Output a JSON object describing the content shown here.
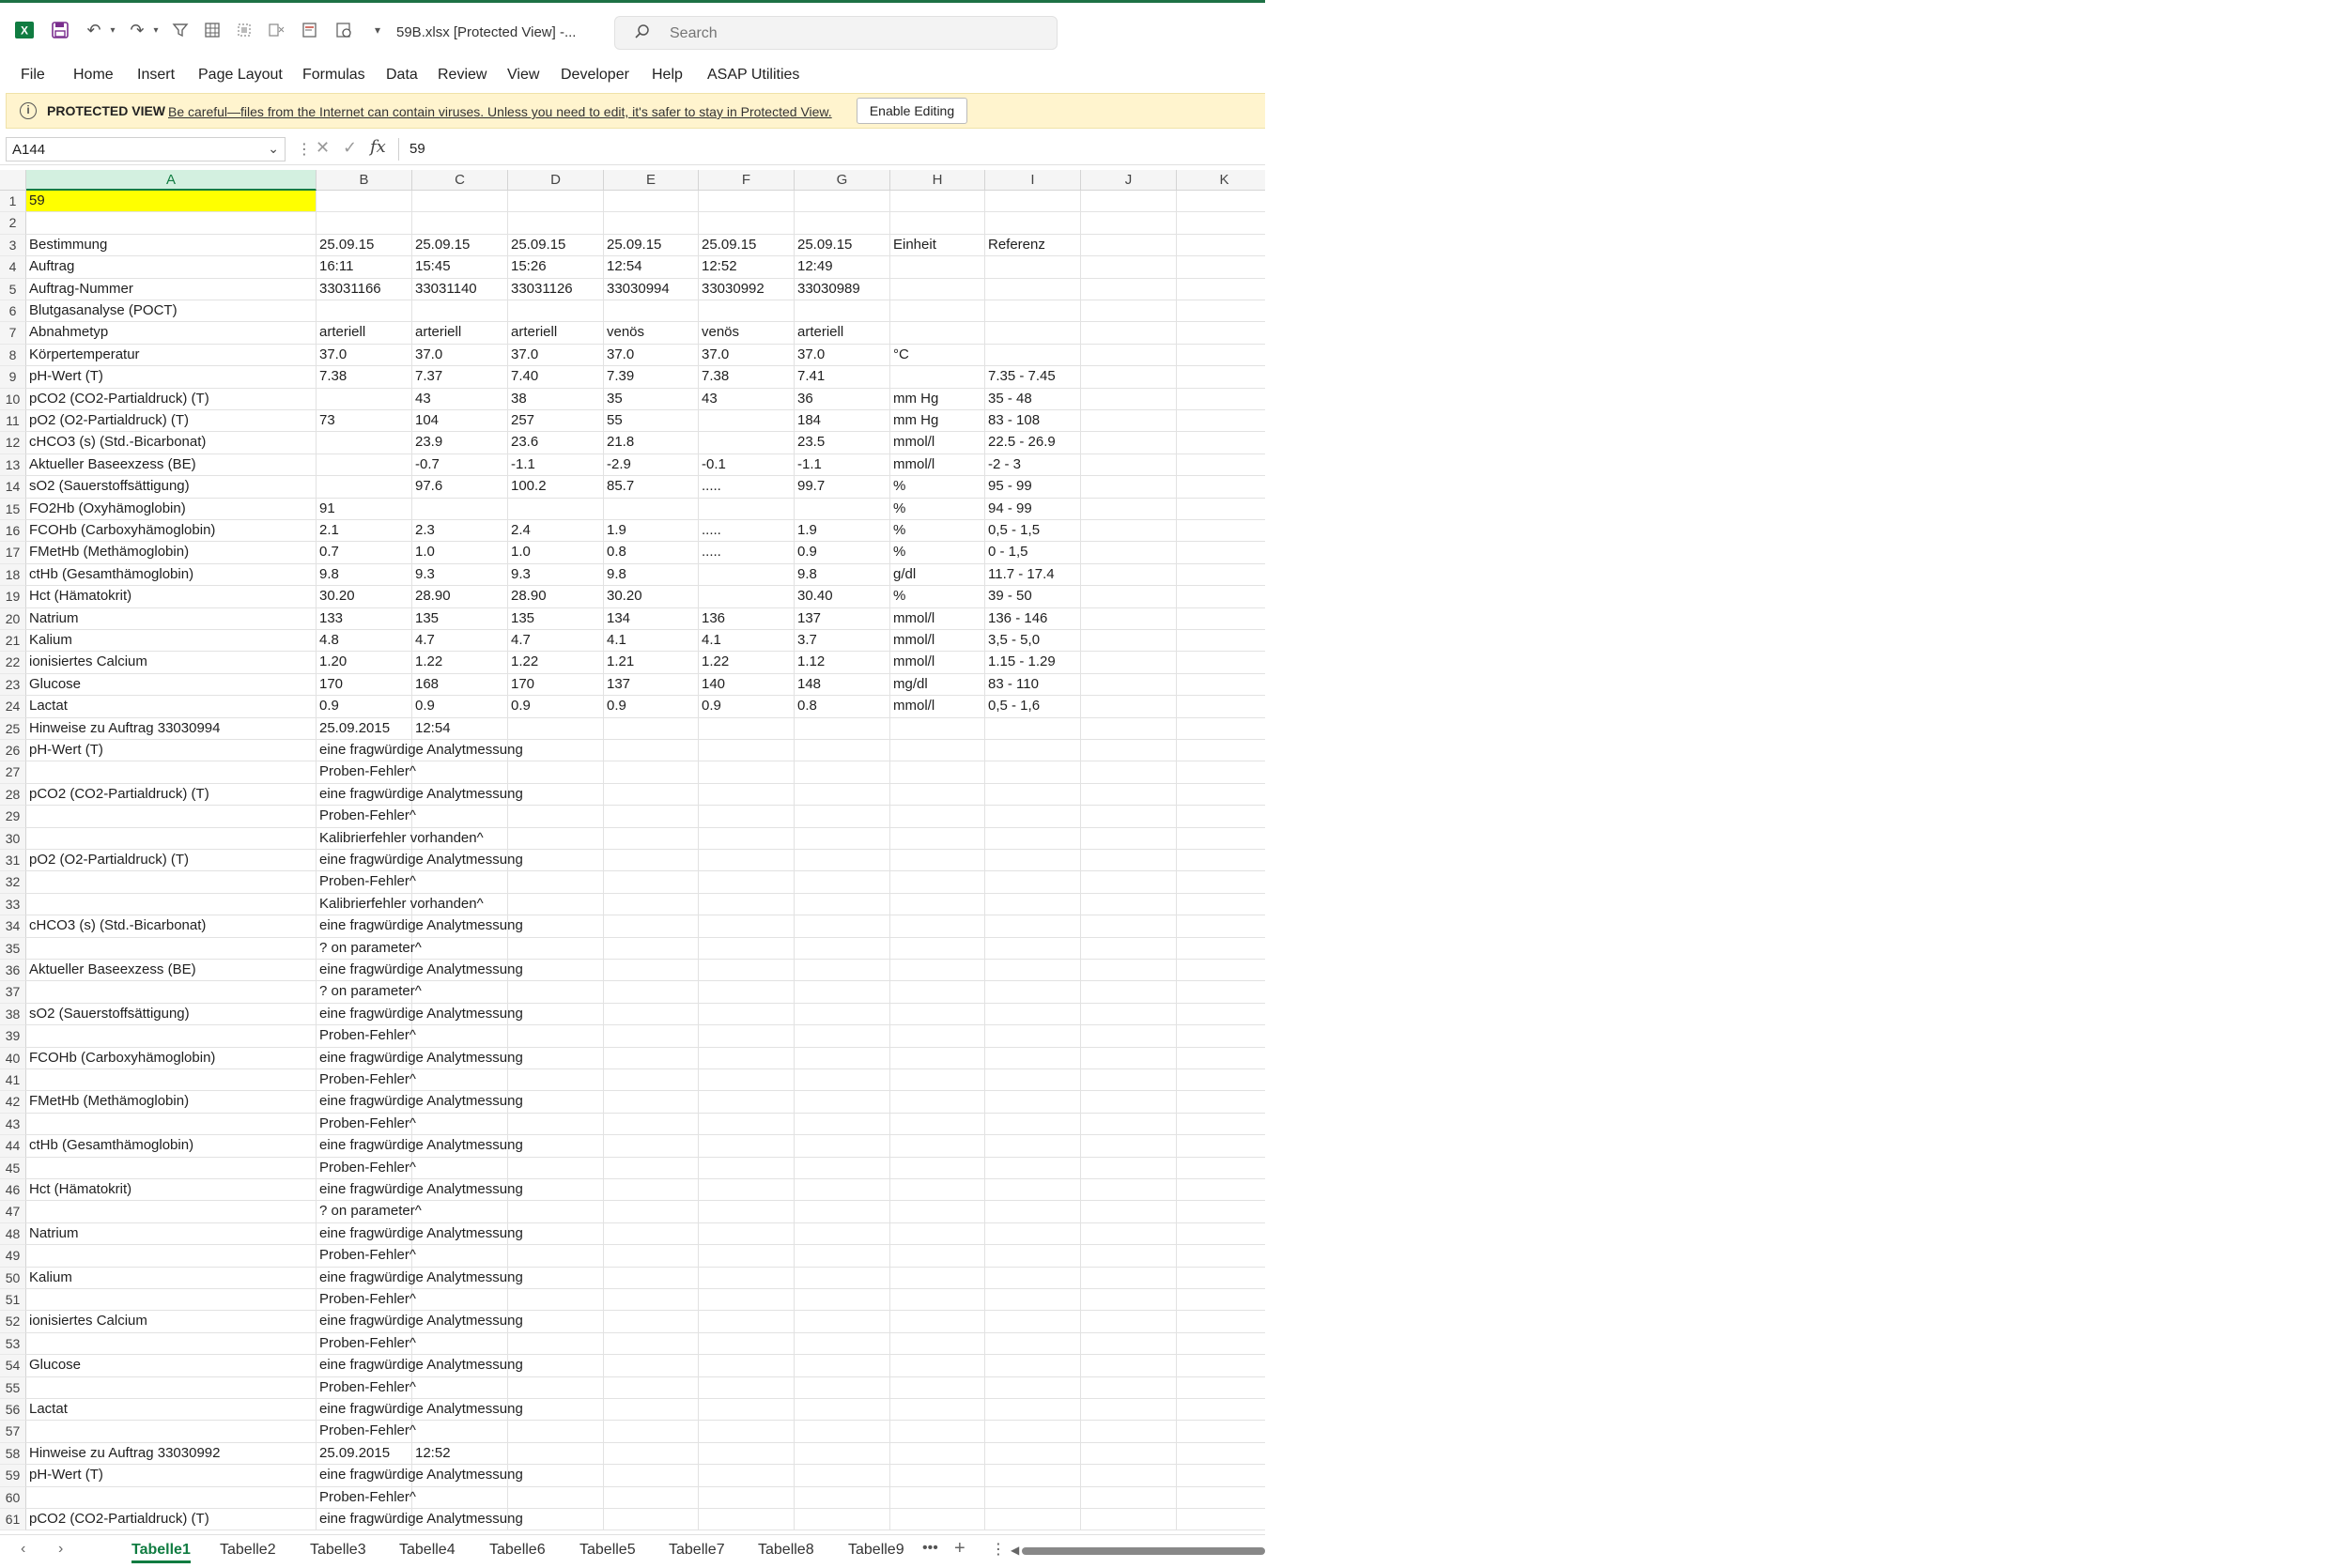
{
  "window": {
    "title": "59B.xlsx  [Protected View]  -..."
  },
  "search": {
    "placeholder": "Search"
  },
  "menu": [
    "File",
    "Home",
    "Insert",
    "Page Layout",
    "Formulas",
    "Data",
    "Review",
    "View",
    "Developer",
    "Help",
    "ASAP Utilities"
  ],
  "protected_view": {
    "label": "PROTECTED VIEW",
    "message": "Be careful—files from the Internet can contain viruses. Unless you need to edit, it's safer to stay in Protected View.",
    "button": "Enable Editing"
  },
  "formula_bar": {
    "name_box": "A144",
    "value": "59"
  },
  "columns": [
    "A",
    "B",
    "C",
    "D",
    "E",
    "F",
    "G",
    "H",
    "I",
    "J",
    "K"
  ],
  "selected_column": "A",
  "rows": [
    [
      "59",
      "",
      "",
      "",
      "",
      "",
      "",
      "",
      ""
    ],
    [
      "",
      "",
      "",
      "",
      "",
      "",
      "",
      "",
      ""
    ],
    [
      "Bestimmung",
      "25.09.15",
      "25.09.15",
      "25.09.15",
      "25.09.15",
      "25.09.15",
      "25.09.15",
      "Einheit",
      "Referenz"
    ],
    [
      "Auftrag",
      "16:11",
      "15:45",
      "15:26",
      "12:54",
      "12:52",
      "12:49",
      "",
      ""
    ],
    [
      "Auftrag-Nummer",
      "33031166",
      "33031140",
      "33031126",
      "33030994",
      "33030992",
      "33030989",
      "",
      ""
    ],
    [
      "Blutgasanalyse (POCT)",
      "",
      "",
      "",
      "",
      "",
      "",
      "",
      ""
    ],
    [
      "Abnahmetyp",
      "arteriell",
      "arteriell",
      "arteriell",
      "venös",
      "venös",
      "arteriell",
      "",
      ""
    ],
    [
      "Körpertemperatur",
      "37.0",
      "37.0",
      "37.0",
      "37.0",
      "37.0",
      "37.0",
      "°C",
      ""
    ],
    [
      "pH-Wert (T)",
      "7.38",
      "7.37",
      "7.40",
      "7.39",
      "7.38",
      "7.41",
      "",
      "7.35 - 7.45"
    ],
    [
      "pCO2 (CO2-Partialdruck) (T)",
      "",
      "43",
      "38",
      "35",
      "43",
      "36",
      "mm Hg",
      "35 - 48"
    ],
    [
      "pO2 (O2-Partialdruck) (T)",
      "73",
      "104",
      "257",
      "55",
      "",
      "184",
      "mm Hg",
      "83 - 108"
    ],
    [
      "cHCO3 (s) (Std.-Bicarbonat)",
      "",
      "23.9",
      "23.6",
      "21.8",
      "",
      "23.5",
      "mmol/l",
      "22.5 - 26.9"
    ],
    [
      "Aktueller Baseexzess (BE)",
      "",
      "-0.7",
      "-1.1",
      "-2.9",
      "-0.1",
      "-1.1",
      "mmol/l",
      "-2 - 3"
    ],
    [
      "sO2 (Sauerstoffsättigung)",
      "",
      "97.6",
      "100.2",
      "85.7",
      ".....",
      "99.7",
      "%",
      "95 - 99"
    ],
    [
      "FO2Hb (Oxyhämoglobin)",
      "91",
      "",
      "",
      "",
      "",
      "",
      "%",
      "94 - 99"
    ],
    [
      "FCOHb (Carboxyhämoglobin)",
      "2.1",
      "2.3",
      "2.4",
      "1.9",
      ".....",
      "1.9",
      "%",
      "0,5 - 1,5"
    ],
    [
      "FMetHb (Methämoglobin)",
      "0.7",
      "1.0",
      "1.0",
      "0.8",
      ".....",
      "0.9",
      "%",
      "0 - 1,5"
    ],
    [
      "ctHb (Gesamthämoglobin)",
      "9.8",
      "9.3",
      "9.3",
      "9.8",
      "",
      "9.8",
      "g/dl",
      "11.7 - 17.4"
    ],
    [
      "Hct (Hämatokrit)",
      "30.20",
      "28.90",
      "28.90",
      "30.20",
      "",
      "30.40",
      "%",
      "39 - 50"
    ],
    [
      "Natrium",
      "133",
      "135",
      "135",
      "134",
      "136",
      "137",
      "mmol/l",
      "136 - 146"
    ],
    [
      "Kalium",
      "4.8",
      "4.7",
      "4.7",
      "4.1",
      "4.1",
      "3.7",
      "mmol/l",
      "3,5 - 5,0"
    ],
    [
      "ionisiertes Calcium",
      "1.20",
      "1.22",
      "1.22",
      "1.21",
      "1.22",
      "1.12",
      "mmol/l",
      "1.15 - 1.29"
    ],
    [
      "Glucose",
      "170",
      "168",
      "170",
      "137",
      "140",
      "148",
      "mg/dl",
      "83 - 110"
    ],
    [
      "Lactat",
      "0.9",
      "0.9",
      "0.9",
      "0.9",
      "0.9",
      "0.8",
      "mmol/l",
      "0,5 - 1,6"
    ],
    [
      "Hinweise zu Auftrag 33030994",
      "25.09.2015",
      "12:54",
      "",
      "",
      "",
      "",
      "",
      ""
    ],
    [
      "pH-Wert (T)",
      "eine fragwürdige Analytmessung",
      "",
      "",
      "",
      "",
      "",
      "",
      ""
    ],
    [
      "",
      "Proben-Fehler^",
      "",
      "",
      "",
      "",
      "",
      "",
      ""
    ],
    [
      "pCO2 (CO2-Partialdruck) (T)",
      "eine fragwürdige Analytmessung",
      "",
      "",
      "",
      "",
      "",
      "",
      ""
    ],
    [
      "",
      "Proben-Fehler^",
      "",
      "",
      "",
      "",
      "",
      "",
      ""
    ],
    [
      "",
      "Kalibrierfehler vorhanden^",
      "",
      "",
      "",
      "",
      "",
      "",
      ""
    ],
    [
      "pO2 (O2-Partialdruck) (T)",
      "eine fragwürdige Analytmessung",
      "",
      "",
      "",
      "",
      "",
      "",
      ""
    ],
    [
      "",
      "Proben-Fehler^",
      "",
      "",
      "",
      "",
      "",
      "",
      ""
    ],
    [
      "",
      "Kalibrierfehler vorhanden^",
      "",
      "",
      "",
      "",
      "",
      "",
      ""
    ],
    [
      "cHCO3 (s) (Std.-Bicarbonat)",
      "eine fragwürdige Analytmessung",
      "",
      "",
      "",
      "",
      "",
      "",
      ""
    ],
    [
      "",
      "? on parameter^",
      "",
      "",
      "",
      "",
      "",
      "",
      ""
    ],
    [
      "Aktueller Baseexzess (BE)",
      "eine fragwürdige Analytmessung",
      "",
      "",
      "",
      "",
      "",
      "",
      ""
    ],
    [
      "",
      "? on parameter^",
      "",
      "",
      "",
      "",
      "",
      "",
      ""
    ],
    [
      "sO2 (Sauerstoffsättigung)",
      "eine fragwürdige Analytmessung",
      "",
      "",
      "",
      "",
      "",
      "",
      ""
    ],
    [
      "",
      "Proben-Fehler^",
      "",
      "",
      "",
      "",
      "",
      "",
      ""
    ],
    [
      "FCOHb (Carboxyhämoglobin)",
      "eine fragwürdige Analytmessung",
      "",
      "",
      "",
      "",
      "",
      "",
      ""
    ],
    [
      "",
      "Proben-Fehler^",
      "",
      "",
      "",
      "",
      "",
      "",
      ""
    ],
    [
      "FMetHb (Methämoglobin)",
      "eine fragwürdige Analytmessung",
      "",
      "",
      "",
      "",
      "",
      "",
      ""
    ],
    [
      "",
      "Proben-Fehler^",
      "",
      "",
      "",
      "",
      "",
      "",
      ""
    ],
    [
      "ctHb (Gesamthämoglobin)",
      "eine fragwürdige Analytmessung",
      "",
      "",
      "",
      "",
      "",
      "",
      ""
    ],
    [
      "",
      "Proben-Fehler^",
      "",
      "",
      "",
      "",
      "",
      "",
      ""
    ],
    [
      "Hct (Hämatokrit)",
      "eine fragwürdige Analytmessung",
      "",
      "",
      "",
      "",
      "",
      "",
      ""
    ],
    [
      "",
      "? on parameter^",
      "",
      "",
      "",
      "",
      "",
      "",
      ""
    ],
    [
      "Natrium",
      "eine fragwürdige Analytmessung",
      "",
      "",
      "",
      "",
      "",
      "",
      ""
    ],
    [
      "",
      "Proben-Fehler^",
      "",
      "",
      "",
      "",
      "",
      "",
      ""
    ],
    [
      "Kalium",
      "eine fragwürdige Analytmessung",
      "",
      "",
      "",
      "",
      "",
      "",
      ""
    ],
    [
      "",
      "Proben-Fehler^",
      "",
      "",
      "",
      "",
      "",
      "",
      ""
    ],
    [
      "ionisiertes Calcium",
      "eine fragwürdige Analytmessung",
      "",
      "",
      "",
      "",
      "",
      "",
      ""
    ],
    [
      "",
      "Proben-Fehler^",
      "",
      "",
      "",
      "",
      "",
      "",
      ""
    ],
    [
      "Glucose",
      "eine fragwürdige Analytmessung",
      "",
      "",
      "",
      "",
      "",
      "",
      ""
    ],
    [
      "",
      "Proben-Fehler^",
      "",
      "",
      "",
      "",
      "",
      "",
      ""
    ],
    [
      "Lactat",
      "eine fragwürdige Analytmessung",
      "",
      "",
      "",
      "",
      "",
      "",
      ""
    ],
    [
      "",
      "Proben-Fehler^",
      "",
      "",
      "",
      "",
      "",
      "",
      ""
    ],
    [
      "Hinweise zu Auftrag 33030992",
      "25.09.2015",
      "12:52",
      "",
      "",
      "",
      "",
      "",
      ""
    ],
    [
      "pH-Wert (T)",
      "eine fragwürdige Analytmessung",
      "",
      "",
      "",
      "",
      "",
      "",
      ""
    ],
    [
      "",
      "Proben-Fehler^",
      "",
      "",
      "",
      "",
      "",
      "",
      ""
    ],
    [
      "pCO2 (CO2-Partialdruck) (T)",
      "eine fragwürdige Analytmessung",
      "",
      "",
      "",
      "",
      "",
      "",
      ""
    ]
  ],
  "sheets": [
    "Tabelle1",
    "Tabelle2",
    "Tabelle3",
    "Tabelle4",
    "Tabelle6",
    "Tabelle5",
    "Tabelle7",
    "Tabelle8",
    "Tabelle9"
  ],
  "active_sheet": "Tabelle1",
  "colors": {
    "excel_green": "#107c41",
    "highlight": "#ffff00",
    "protected_bar": "#fff4ce"
  }
}
